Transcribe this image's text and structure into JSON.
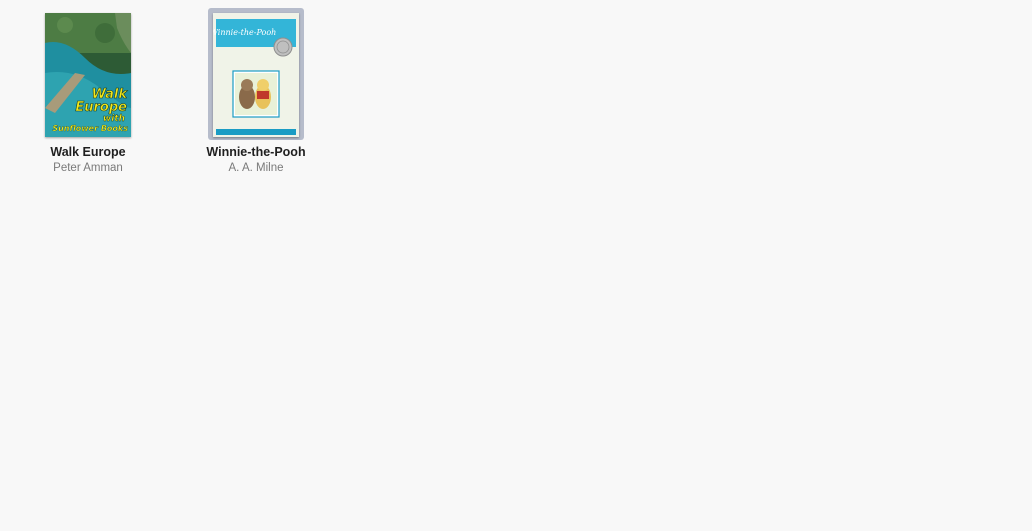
{
  "books": [
    {
      "title": "Walk Europe",
      "author": "Peter Amman",
      "selected": false,
      "cover": {
        "lines": [
          "Walk",
          "Europe",
          "with",
          "Sunflower Books"
        ],
        "colors": {
          "water": "#1f8fa0",
          "forest": "#3e6f3a",
          "text": "#f2e91b"
        }
      }
    },
    {
      "title": "Winnie-the-Pooh",
      "author": "A. A. Milne",
      "selected": true,
      "cover": {
        "title": "Winnie-the-Pooh",
        "colors": {
          "banner": "#33b5d8",
          "background": "#f7f3dc",
          "frame": "#1a9cc4"
        }
      }
    }
  ],
  "colors": {
    "background": "#f8f8f8",
    "selection": "#b6bccb",
    "title_text": "#1f1f1f",
    "author_text": "#7a7a7a"
  }
}
